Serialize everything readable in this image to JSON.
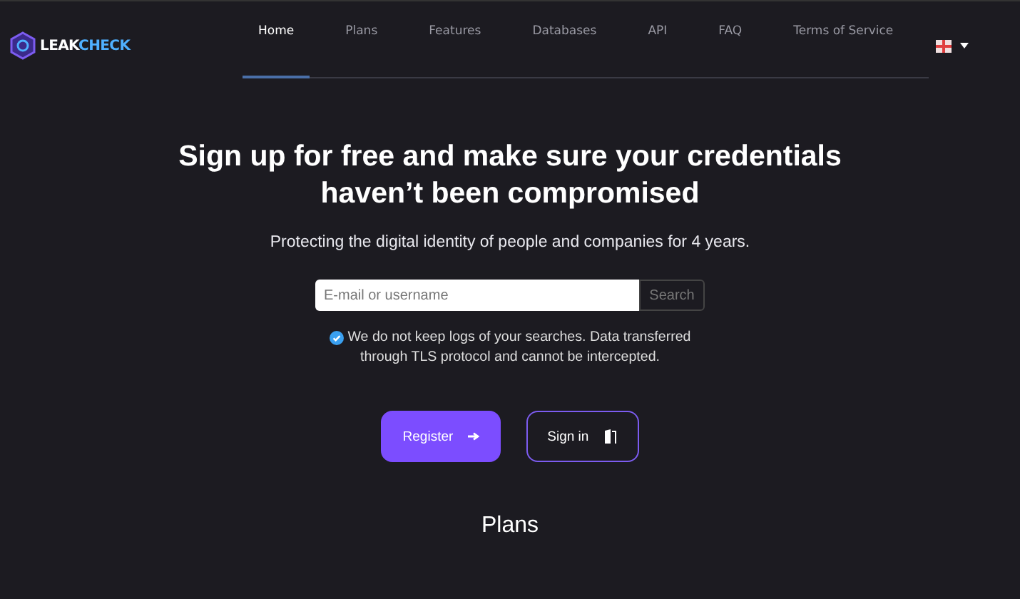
{
  "logo": {
    "part_1": "LEAK",
    "part_2": "CHECK"
  },
  "nav": [
    {
      "label": "Home",
      "selected": true
    },
    {
      "label": "Plans",
      "selected": false
    },
    {
      "label": "Features",
      "selected": false
    },
    {
      "label": "Databases",
      "selected": false
    },
    {
      "label": "API",
      "selected": false
    },
    {
      "label": "FAQ",
      "selected": false
    },
    {
      "label": "Terms of Service",
      "selected": false
    }
  ],
  "hero": {
    "title_line_1": "Sign up for free and make sure your credentials",
    "title_line_2": "haven’t been compromised",
    "subtitle": "Protecting the digital identity of people and companies for 4 years."
  },
  "search": {
    "placeholder": "E-mail or username",
    "button": "Search"
  },
  "note": {
    "checked": true,
    "line_1": "We do not keep logs of your searches. Data transferred",
    "line_2": "through TLS protocol and cannot be intercepted."
  },
  "buttons": [
    {
      "kind": "primary",
      "label": "Register"
    },
    {
      "kind": "outline",
      "label": "Sign in"
    }
  ],
  "plans_heading": "Plans"
}
